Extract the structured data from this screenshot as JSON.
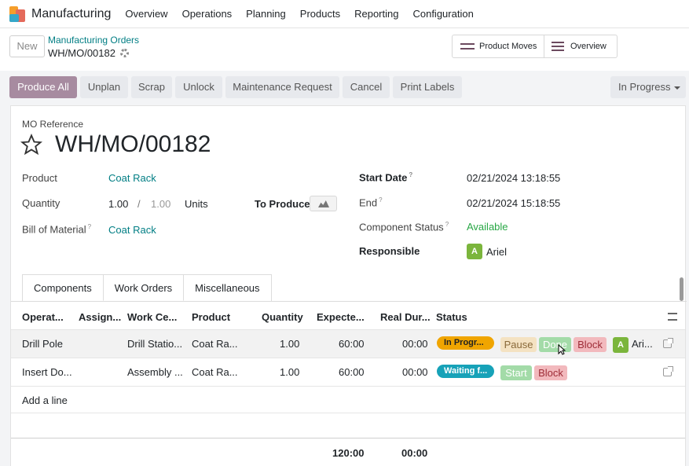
{
  "topbar": {
    "app_name": "Manufacturing",
    "nav": [
      "Overview",
      "Operations",
      "Planning",
      "Products",
      "Reporting",
      "Configuration"
    ]
  },
  "controlbar": {
    "new_label": "New",
    "breadcrumb_parent": "Manufacturing Orders",
    "breadcrumb_current": "WH/MO/00182",
    "product_moves_label": "Product Moves",
    "overview_label": "Overview"
  },
  "actions": {
    "buttons": [
      "Produce All",
      "Unplan",
      "Scrap",
      "Unlock",
      "Maintenance Request",
      "Cancel",
      "Print Labels"
    ],
    "status": "In Progress"
  },
  "form": {
    "reference_label": "MO Reference",
    "reference": "WH/MO/00182",
    "product_label": "Product",
    "product": "Coat Rack",
    "quantity_label": "Quantity",
    "quantity": "1.00",
    "quantity_sep": "/",
    "quantity_total": "1.00",
    "uom": "Units",
    "to_produce_label": "To Produce",
    "bom_label": "Bill of Material",
    "bom": "Coat Rack",
    "start_label": "Start Date",
    "start": "02/21/2024 13:18:55",
    "end_label": "End",
    "end": "02/21/2024 15:18:55",
    "component_status_label": "Component Status",
    "component_status": "Available",
    "responsible_label": "Responsible",
    "responsible_initial": "A",
    "responsible": "Ariel",
    "help_mark": "?"
  },
  "tabs": [
    "Components",
    "Work Orders",
    "Miscellaneous"
  ],
  "table": {
    "headers": [
      "Operat...",
      "Assign...",
      "Work Ce...",
      "Product",
      "Quantity",
      "Expecte...",
      "Real Dur...",
      "Status"
    ],
    "rows": [
      {
        "operation": "Drill Pole",
        "work_center": "Drill Statio...",
        "product": "Coat Ra...",
        "quantity": "1.00",
        "expected": "60:00",
        "real": "00:00",
        "status": "In Progr...",
        "buttons": [
          "Pause",
          "Done",
          "Block"
        ],
        "user_initial": "A",
        "user": "Ari..."
      },
      {
        "operation": "Insert Do...",
        "work_center": "Assembly ...",
        "product": "Coat Ra...",
        "quantity": "1.00",
        "expected": "60:00",
        "real": "00:00",
        "status": "Waiting f...",
        "buttons": [
          "Start",
          "Block"
        ]
      }
    ],
    "add_line": "Add a line",
    "total_expected": "120:00",
    "total_real": "00:00"
  },
  "colors": {
    "brand": "#a78ba0",
    "link": "#017e84",
    "in_progress": "#f0a500",
    "waiting": "#17a2b8",
    "available": "#28a745"
  }
}
